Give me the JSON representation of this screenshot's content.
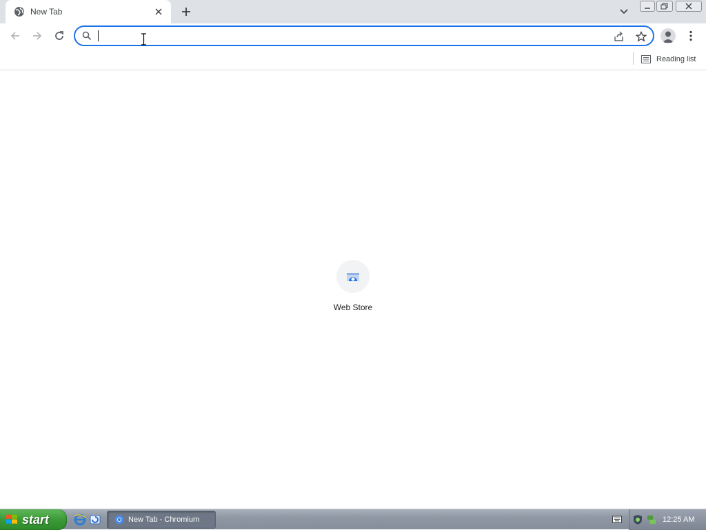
{
  "browser": {
    "tab": {
      "title": "New Tab"
    },
    "omnibox": {
      "value": "",
      "placeholder": ""
    },
    "bookmarks_bar": {
      "reading_list_label": "Reading list"
    }
  },
  "page": {
    "shortcuts": [
      {
        "label": "Web Store"
      }
    ]
  },
  "taskbar": {
    "start_label": "start",
    "window_button_label": "New Tab - Chromium",
    "clock": "12:25 AM"
  },
  "colors": {
    "accent": "#1a73e8",
    "tabstrip_bg": "#dee1e6",
    "start_green": "#3c9a38"
  },
  "icons": {
    "tab_favicon": "globe-icon",
    "omnibox": "search-icon",
    "share": "share-icon",
    "bookmark": "star-icon",
    "profile": "profile-icon",
    "menu": "more-vert-icon",
    "reading_list": "reading-list-icon",
    "shortcut": "web-store-icon"
  }
}
